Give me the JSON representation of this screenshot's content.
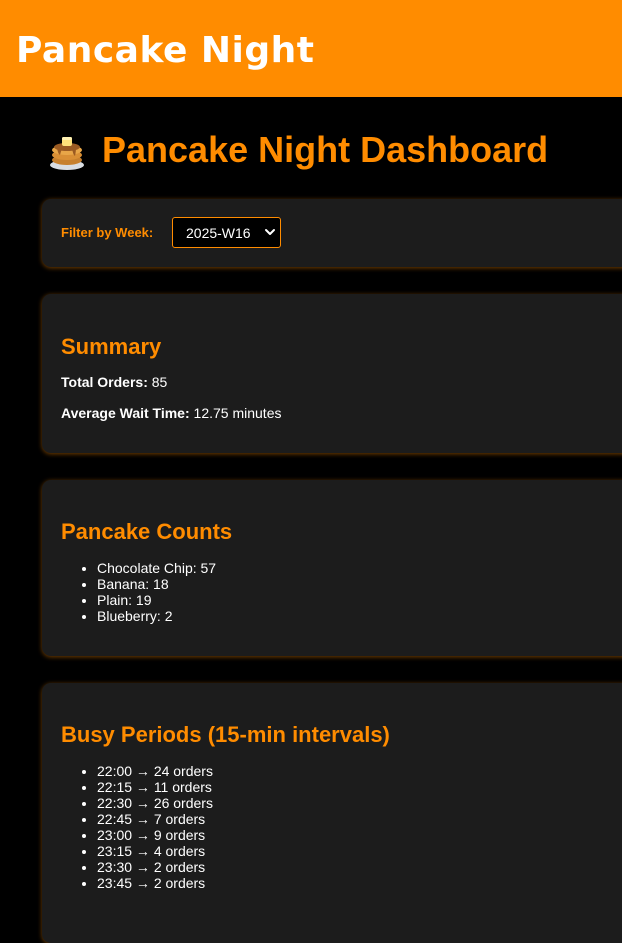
{
  "app": {
    "title": "Pancake Night"
  },
  "page": {
    "heading": "Pancake Night Dashboard",
    "heading_icon": "pancake-stack-icon"
  },
  "filter": {
    "label": "Filter by Week:",
    "selected_week": "2025-W16"
  },
  "summary": {
    "title": "Summary",
    "total_orders_label": "Total Orders:",
    "total_orders_value": "85",
    "avg_wait_label": "Average Wait Time:",
    "avg_wait_value": "12.75 minutes"
  },
  "pancake_counts": {
    "title": "Pancake Counts",
    "items": [
      "Chocolate Chip: 57",
      "Banana: 18",
      "Plain: 19",
      "Blueberry: 2"
    ]
  },
  "busy_periods": {
    "title": "Busy Periods (15-min intervals)",
    "items": [
      "22:00 → 24 orders",
      "22:15 → 11 orders",
      "22:30 → 26 orders",
      "22:45 → 7 orders",
      "23:00 → 9 orders",
      "23:15 → 4 orders",
      "23:30 → 2 orders",
      "23:45 → 2 orders"
    ]
  },
  "colors": {
    "accent": "#ff8c00",
    "background": "#000000",
    "card": "#1c1c1c",
    "text": "#ffffff"
  }
}
